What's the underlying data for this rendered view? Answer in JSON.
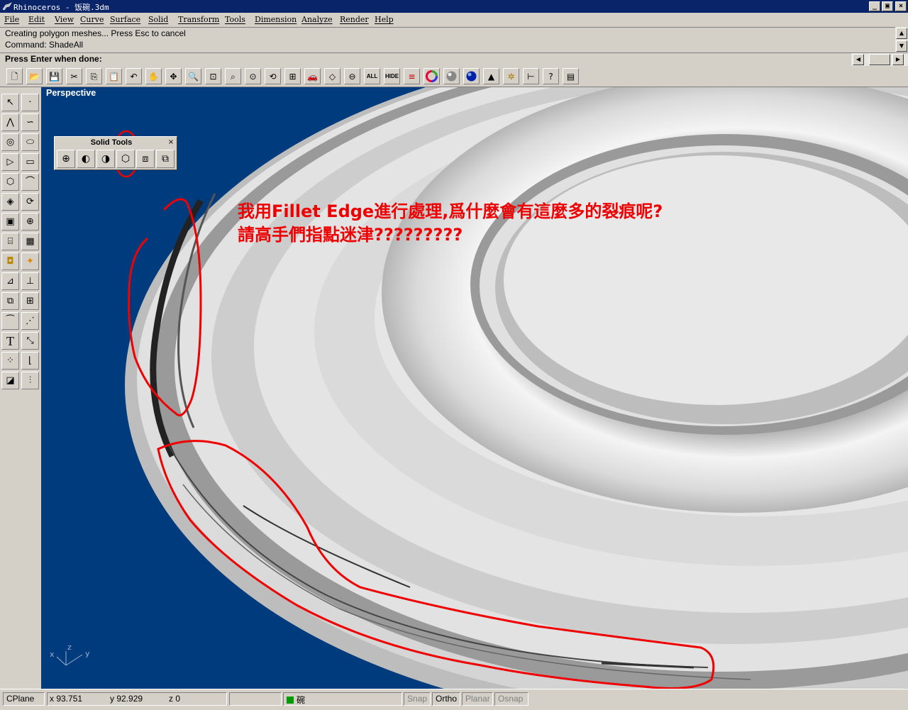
{
  "window": {
    "title": "Rhinoceros - 饭碗.3dm",
    "controls": {
      "minimize": "_",
      "maximize": "▣",
      "close": "×"
    }
  },
  "menu": [
    "File",
    "Edit",
    "View",
    "Curve",
    "Surface",
    "Solid",
    "Transform",
    "Tools",
    "Dimension",
    "Analyze",
    "Render",
    "Help"
  ],
  "command_history": {
    "line1": "Creating polygon meshes... Press Esc to cancel",
    "line2": "Command: ShadeAll"
  },
  "prompt": {
    "label": "Press Enter when done:",
    "value": ""
  },
  "toolbar": {
    "all_label": "ALL",
    "hide_label": "HIDE",
    "icons": [
      "new-icon",
      "open-icon",
      "save-icon",
      "cut-icon",
      "copy-icon",
      "paste-icon",
      "undo-icon",
      "pan-hand-icon",
      "rotate-view-icon",
      "zoom-dynamic-icon",
      "zoom-window-icon",
      "zoom-extents-icon",
      "zoom-selected-icon",
      "undo-view-icon",
      "four-viewports-icon",
      "car-object-icon",
      "cplane-icon",
      "point-icon",
      "show-all-icon",
      "hide-icon",
      "layers-icon",
      "color-wheel-icon",
      "render-sphere-icon",
      "shade-sphere-icon",
      "spotlight-icon",
      "gear-icon",
      "dimension-icon",
      "help-icon",
      "properties-icon"
    ]
  },
  "viewport": {
    "label": "Perspective",
    "axis_labels": {
      "x": "x",
      "y": "y",
      "z": "z"
    }
  },
  "annotation": {
    "line1": "我用Fillet Edge進行處理,爲什麼會有這麼多的裂痕呢?",
    "line2": "請高手們指點迷津?????????"
  },
  "solid_tools": {
    "title": "Solid Tools",
    "close": "×",
    "buttons": [
      "boolean-union-icon",
      "boolean-difference-icon",
      "boolean-intersection-icon",
      "fillet-edge-icon",
      "chamfer-edge-icon",
      "extract-surface-icon"
    ]
  },
  "statusbar": {
    "cplane": "CPlane",
    "x": "x 93.751",
    "y": "y 92.929",
    "z": "z 0",
    "layer": "碗",
    "snap": "Snap",
    "ortho": "Ortho",
    "planar": "Planar",
    "osnap": "Osnap"
  },
  "colors": {
    "titlebar": "#0a246a",
    "chrome": "#d4d0c8",
    "viewport_bg": "#003c7d",
    "annotation": "#ee0000",
    "layer_swatch": "#009900"
  }
}
